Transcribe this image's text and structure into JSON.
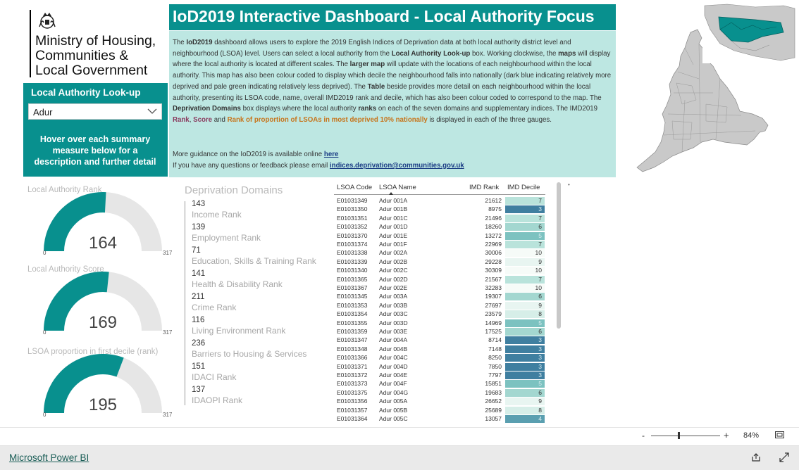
{
  "logo": {
    "ministry_line1": "Ministry of Housing,",
    "ministry_line2": "Communities &",
    "ministry_line3": "Local Government"
  },
  "lookup": {
    "title": "Local Authority Look-up",
    "selected": "Adur",
    "hover_note": "Hover over each summary measure below for a description and further detail"
  },
  "header": {
    "title": "IoD2019 Interactive Dashboard - Local Authority Focus"
  },
  "description": {
    "p1": "The",
    "b1": "IoD2019",
    "p2": "dashboard allows users to explore the 2019 English Indices of Deprivation data at both local authority district level and neighbourhood (LSOA) level. Users can select a local authority from the",
    "b2": "Local Authority Look-up",
    "p3": "box. Working clockwise, the",
    "b3": "maps",
    "p4": "will display where the local authority is located at different scales. The",
    "b4": "larger map",
    "p5": "will update with the locations of each neighbourhood within the local authority. This map has also been colour coded to display which decile the neighbourhood falls into nationally (dark blue indicating relatively more deprived and pale green indicating relatively less deprived). The",
    "b5": "Table",
    "p6": "beside provides more detail on each neighbourhood within the local authority, presenting its LSOA code, name, overall IMD2019 rank and decile, which has also been colour coded to correspond to the map. The",
    "b6": "Deprivation Domains",
    "p7": "box displays where the local authority",
    "b7": "ranks",
    "p8": "on each of the seven domains and supplementary indices. The IMD2019",
    "c1": "Rank",
    "p9": ",",
    "c2": "Score",
    "p10": "and",
    "c3": "Rank of proportion of LSOAs in most deprived 10% nationally",
    "p11": "is displayed in each of the three gauges.",
    "guidance_text": "More guidance on the IoD2019 is available online",
    "guidance_link": "here",
    "feedback_text": "If you have any questions or feedback please email",
    "feedback_link": "indices.deprivation@communities.gov.uk"
  },
  "gauges": [
    {
      "title": "Local Authority Rank",
      "value": "164",
      "min": "0",
      "max": "317",
      "fraction": 0.517,
      "color": "#08908e"
    },
    {
      "title": "Local Authority Score",
      "value": "169",
      "min": "0",
      "max": "317",
      "fraction": 0.533,
      "color": "#08908e"
    },
    {
      "title": "LSOA proportion in first decile (rank)",
      "value": "195",
      "min": "0",
      "max": "317",
      "fraction": 0.615,
      "color": "#08908e"
    }
  ],
  "domains": {
    "title": "Deprivation Domains",
    "items": [
      {
        "value": "143",
        "label": "Income Rank"
      },
      {
        "value": "139",
        "label": "Employment Rank"
      },
      {
        "value": "71",
        "label": "Education, Skills & Training Rank"
      },
      {
        "value": "141",
        "label": "Health & Disability Rank"
      },
      {
        "value": "211",
        "label": "Crime Rank"
      },
      {
        "value": "116",
        "label": "Living Environment Rank"
      },
      {
        "value": "236",
        "label": "Barriers to Housing & Services"
      },
      {
        "value": "151",
        "label": "IDACI Rank"
      },
      {
        "value": "137",
        "label": "IDAOPI Rank"
      }
    ]
  },
  "table": {
    "headers": [
      "LSOA Code",
      "LSOA Name",
      "IMD Rank",
      "IMD Decile"
    ],
    "rows": [
      [
        "E01031349",
        "Adur 001A",
        "21612",
        "7"
      ],
      [
        "E01031350",
        "Adur 001B",
        "8975",
        "3"
      ],
      [
        "E01031351",
        "Adur 001C",
        "21496",
        "7"
      ],
      [
        "E01031352",
        "Adur 001D",
        "18260",
        "6"
      ],
      [
        "E01031370",
        "Adur 001E",
        "13272",
        "5"
      ],
      [
        "E01031374",
        "Adur 001F",
        "22969",
        "7"
      ],
      [
        "E01031338",
        "Adur 002A",
        "30006",
        "10"
      ],
      [
        "E01031339",
        "Adur 002B",
        "29228",
        "9"
      ],
      [
        "E01031340",
        "Adur 002C",
        "30309",
        "10"
      ],
      [
        "E01031365",
        "Adur 002D",
        "21567",
        "7"
      ],
      [
        "E01031367",
        "Adur 002E",
        "32283",
        "10"
      ],
      [
        "E01031345",
        "Adur 003A",
        "19307",
        "6"
      ],
      [
        "E01031353",
        "Adur 003B",
        "27697",
        "9"
      ],
      [
        "E01031354",
        "Adur 003C",
        "23579",
        "8"
      ],
      [
        "E01031355",
        "Adur 003D",
        "14969",
        "5"
      ],
      [
        "E01031359",
        "Adur 003E",
        "17525",
        "6"
      ],
      [
        "E01031347",
        "Adur 004A",
        "8714",
        "3"
      ],
      [
        "E01031348",
        "Adur 004B",
        "7148",
        "3"
      ],
      [
        "E01031366",
        "Adur 004C",
        "8250",
        "3"
      ],
      [
        "E01031371",
        "Adur 004D",
        "7850",
        "3"
      ],
      [
        "E01031372",
        "Adur 004E",
        "7797",
        "3"
      ],
      [
        "E01031373",
        "Adur 004F",
        "15851",
        "5"
      ],
      [
        "E01031375",
        "Adur 004G",
        "19683",
        "6"
      ],
      [
        "E01031356",
        "Adur 005A",
        "26652",
        "9"
      ],
      [
        "E01031357",
        "Adur 005B",
        "25689",
        "8"
      ],
      [
        "E01031364",
        "Adur 005C",
        "13057",
        "4"
      ]
    ],
    "decile_colors": {
      "3": "#3f7fa0",
      "4": "#5a9fb0",
      "5": "#7cc2c0",
      "6": "#a3d7d0",
      "7": "#b9e3db",
      "8": "#d6eee8",
      "9": "#e8f5f1",
      "10": "#f6fbf8"
    }
  },
  "zoom": {
    "minus": "-",
    "plus": "+",
    "level": "84%",
    "fraction": 0.4
  },
  "footer": {
    "brand": "Microsoft Power BI"
  },
  "icons": {
    "share": "share-icon",
    "expand": "expand-icon",
    "fit": "fit-to-page-icon",
    "chevron": "chevron-down-icon"
  }
}
